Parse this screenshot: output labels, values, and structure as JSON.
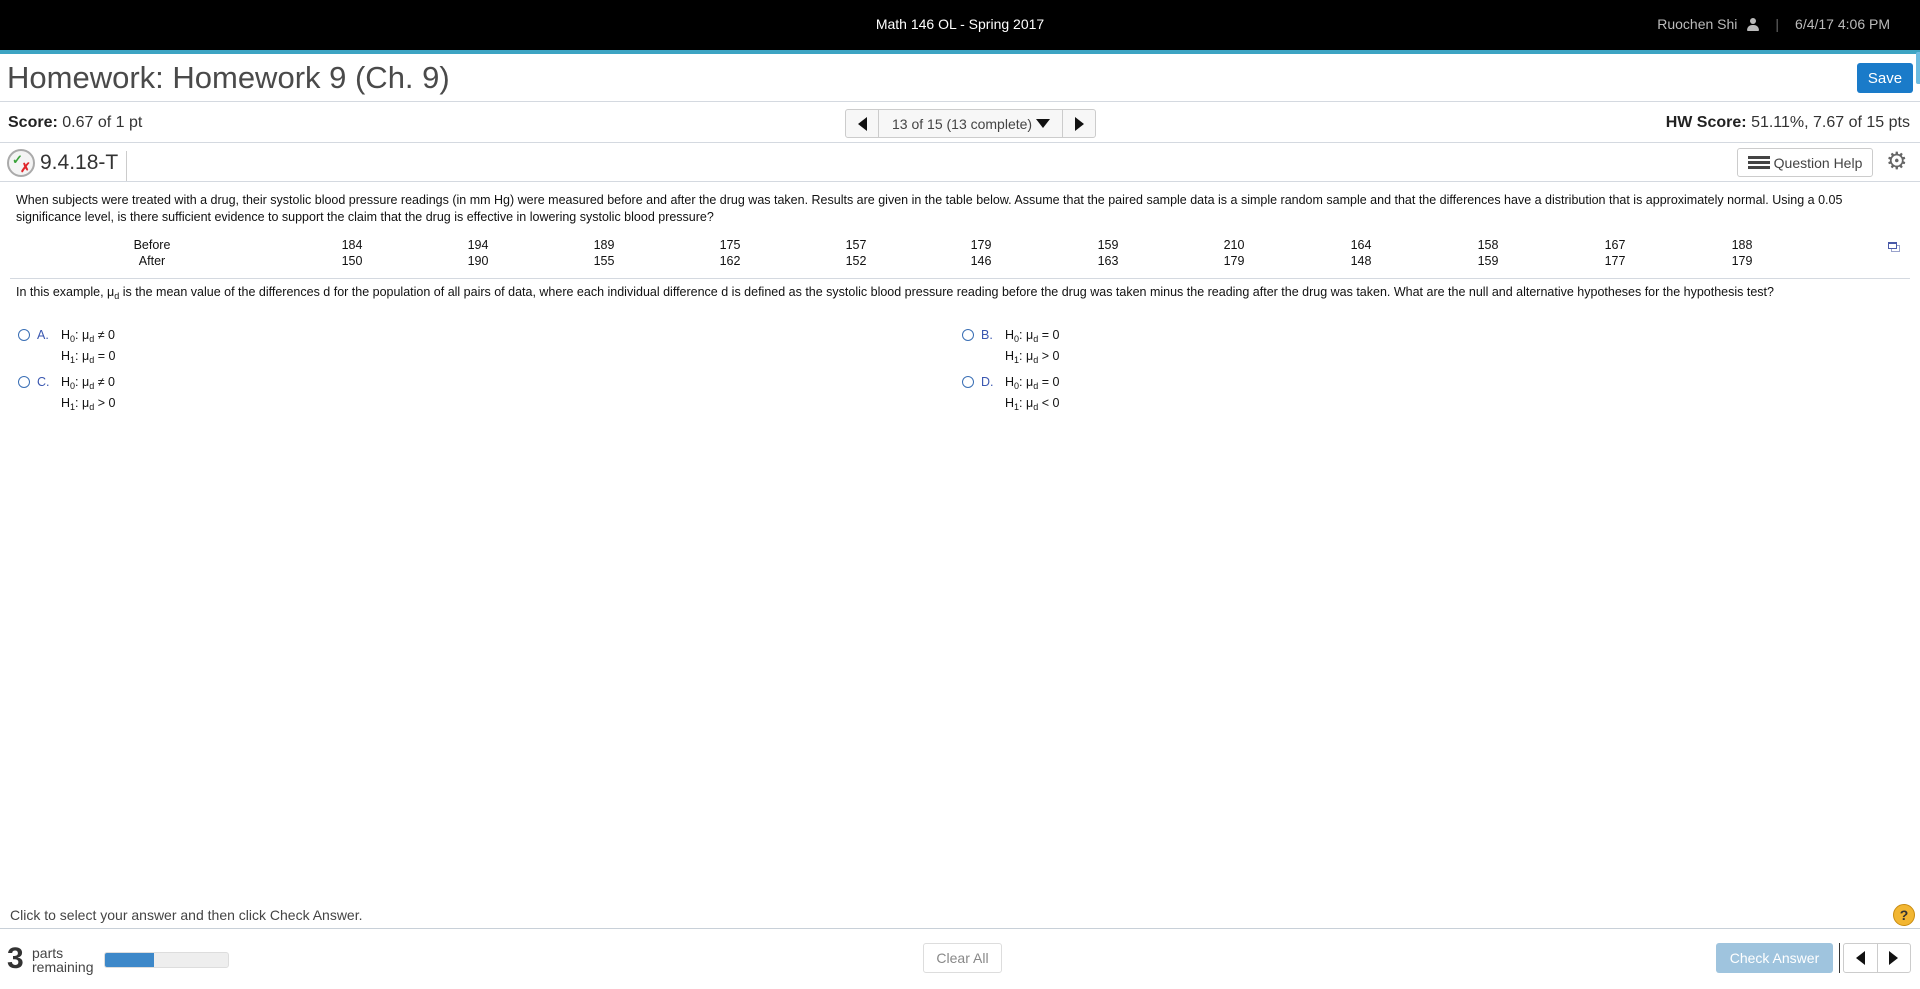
{
  "topbar": {
    "course": "Math 146 OL - Spring 2017",
    "user": "Ruochen Shi",
    "user_icon": "user-icon",
    "separator": "|",
    "datetime": "6/4/17 4:06 PM"
  },
  "header": {
    "title": "Homework: Homework 9 (Ch. 9)",
    "save_label": "Save"
  },
  "scorebar": {
    "score_label": "Score:",
    "score_value": "0.67 of 1 pt",
    "nav_text": "13 of 15 (13 complete)",
    "hw_score_label": "HW Score:",
    "hw_score_value": "51.11%, 7.67 of 15 pts"
  },
  "question_bar": {
    "status_icon": "partial-correct-icon",
    "question_id": "9.4.18-T",
    "help_label": "Question Help",
    "settings_icon": "gear-icon"
  },
  "problem": {
    "text": "When subjects were treated with a drug, their systolic blood pressure readings (in mm Hg) were measured before and after the drug was taken. Results are given in the table below. Assume that the paired sample data is a simple random sample and that the differences have a distribution that is approximately normal. Using a 0.05 significance level, is there sufficient evidence to support the claim that the drug is effective in lowering systolic blood pressure?",
    "table": {
      "rows": [
        {
          "label": "Before",
          "values": [
            "184",
            "194",
            "189",
            "175",
            "157",
            "179",
            "159",
            "210",
            "164",
            "158",
            "167",
            "188"
          ]
        },
        {
          "label": "After",
          "values": [
            "150",
            "190",
            "155",
            "162",
            "152",
            "146",
            "163",
            "179",
            "148",
            "159",
            "177",
            "179"
          ]
        }
      ]
    },
    "question_pre": "In this example, μ",
    "question_sub": "d",
    "question_post": " is the mean value of the differences d for the population of all pairs of data, where each individual difference d is defined as the systolic blood pressure reading before the drug was taken minus the reading after the drug was taken. What are the null and alternative hypotheses for the hypothesis test?"
  },
  "options": [
    {
      "letter": "A.",
      "h0": "≠ 0",
      "h1": "= 0"
    },
    {
      "letter": "B.",
      "h0": "= 0",
      "h1": "> 0"
    },
    {
      "letter": "C.",
      "h0": "≠ 0",
      "h1": "> 0"
    },
    {
      "letter": "D.",
      "h0": "= 0",
      "h1": "< 0"
    }
  ],
  "footer": {
    "instruction": "Click to select your answer and then click Check Answer.",
    "parts_remaining": "3",
    "parts_label_1": "parts",
    "parts_label_2": "remaining",
    "progress_fraction": 0.4,
    "clear_label": "Clear All",
    "check_label": "Check Answer",
    "help_symbol": "?"
  },
  "colors": {
    "accent_line": "#3da4c3",
    "save_button": "#1a7bc9",
    "option_letter": "#3a57b0",
    "progress_fill": "#3d88c9",
    "check_button_disabled": "#9fc4de"
  }
}
